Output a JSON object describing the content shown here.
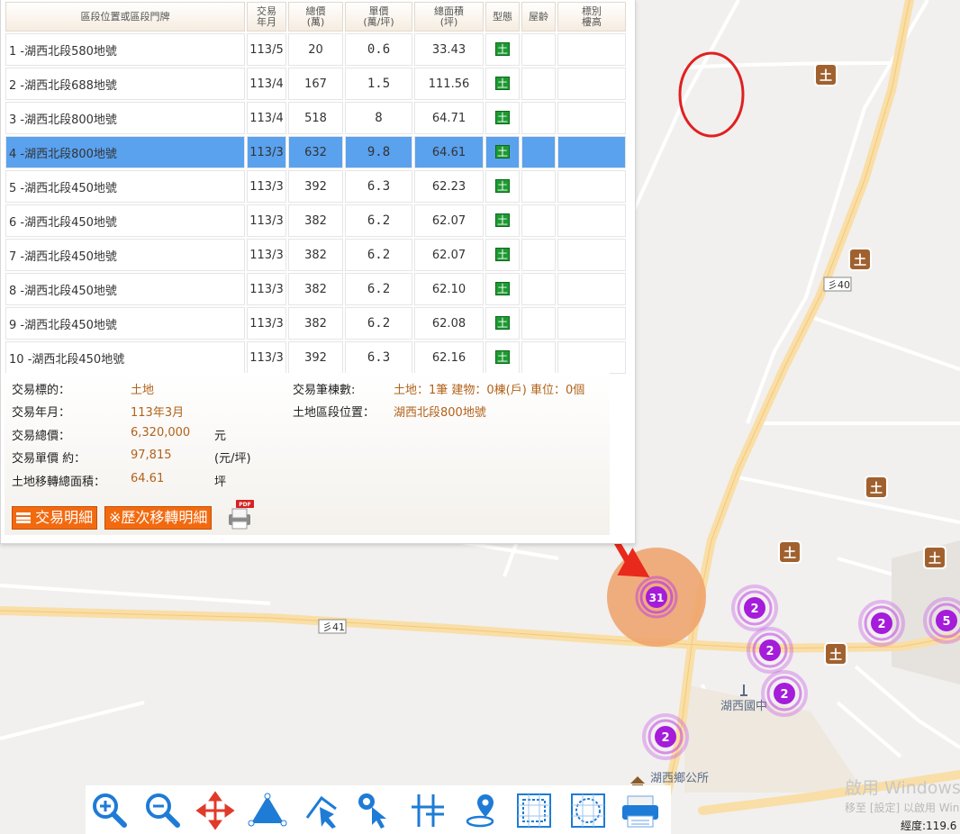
{
  "table": {
    "headers": [
      "區段位置或區段門牌",
      "交易\n年月",
      "總價\n(萬)",
      "單價\n(萬/坪)",
      "總面積\n(坪)",
      "型態",
      "屋齡",
      "標別\n樓高"
    ],
    "rows": [
      {
        "no": "1",
        "addr": "-湖西北段580地號",
        "ym": "113/5",
        "total": "20",
        "unit": "0.6",
        "area": "33.43",
        "type": "土"
      },
      {
        "no": "2",
        "addr": "-湖西北段688地號",
        "ym": "113/4",
        "total": "167",
        "unit": "1.5",
        "area": "111.56",
        "type": "土"
      },
      {
        "no": "3",
        "addr": "-湖西北段800地號",
        "ym": "113/4",
        "total": "518",
        "unit": "8",
        "area": "64.71",
        "type": "土"
      },
      {
        "no": "4",
        "addr": "-湖西北段800地號",
        "ym": "113/3",
        "total": "632",
        "unit": "9.8",
        "area": "64.61",
        "type": "土"
      },
      {
        "no": "5",
        "addr": "-湖西北段450地號",
        "ym": "113/3",
        "total": "392",
        "unit": "6.3",
        "area": "62.23",
        "type": "土"
      },
      {
        "no": "6",
        "addr": "-湖西北段450地號",
        "ym": "113/3",
        "total": "382",
        "unit": "6.2",
        "area": "62.07",
        "type": "土"
      },
      {
        "no": "7",
        "addr": "-湖西北段450地號",
        "ym": "113/3",
        "total": "382",
        "unit": "6.2",
        "area": "62.07",
        "type": "土"
      },
      {
        "no": "8",
        "addr": "-湖西北段450地號",
        "ym": "113/3",
        "total": "382",
        "unit": "6.2",
        "area": "62.10",
        "type": "土"
      },
      {
        "no": "9",
        "addr": "-湖西北段450地號",
        "ym": "113/3",
        "total": "382",
        "unit": "6.2",
        "area": "62.08",
        "type": "土"
      },
      {
        "no": "10",
        "addr": "-湖西北段450地號",
        "ym": "113/3",
        "total": "392",
        "unit": "6.3",
        "area": "62.16",
        "type": "土"
      }
    ],
    "selected_row": 3
  },
  "details": {
    "subject_label": "交易標的：",
    "subject_value": "土地",
    "ym_label": "交易年月：",
    "ym_value": "113年3月",
    "total_label": "交易總價：",
    "total_value": "6,320,000",
    "total_unit": "元",
    "unit_label": "交易單價 約：",
    "unit_value": "97,815",
    "unit_unit": "(元/坪)",
    "area_label": "土地移轉總面積：",
    "area_value": "64.61",
    "area_unit": "坪",
    "count_label": "交易筆棟數:",
    "count_value": "土地：1筆 建物：0棟(戶) 車位：0個",
    "loc_label": "土地區段位置：",
    "loc_value": "湖西北段800地號",
    "btn_detail": "交易明細",
    "btn_history": "※歷次移轉明細",
    "pdf_label": "PDF"
  },
  "map": {
    "road_labels": [
      "彡40",
      "彡41"
    ],
    "place_labels": [
      "湖西國中",
      "湖西鄉公所"
    ],
    "land_marker": "土",
    "clusters": [
      "31",
      "2",
      "2",
      "2",
      "2",
      "2",
      "5"
    ],
    "watermark_title": "啟用 Windows",
    "watermark_sub": "移至 [設定] 以啟用 Windows。",
    "coord_label": "經度:119.6"
  },
  "colors": {
    "selected_row": "#5aa1ee",
    "accent_orange": "#f26a10",
    "arrow_red": "#e8291c",
    "cluster_purple": "#a51cdb"
  }
}
